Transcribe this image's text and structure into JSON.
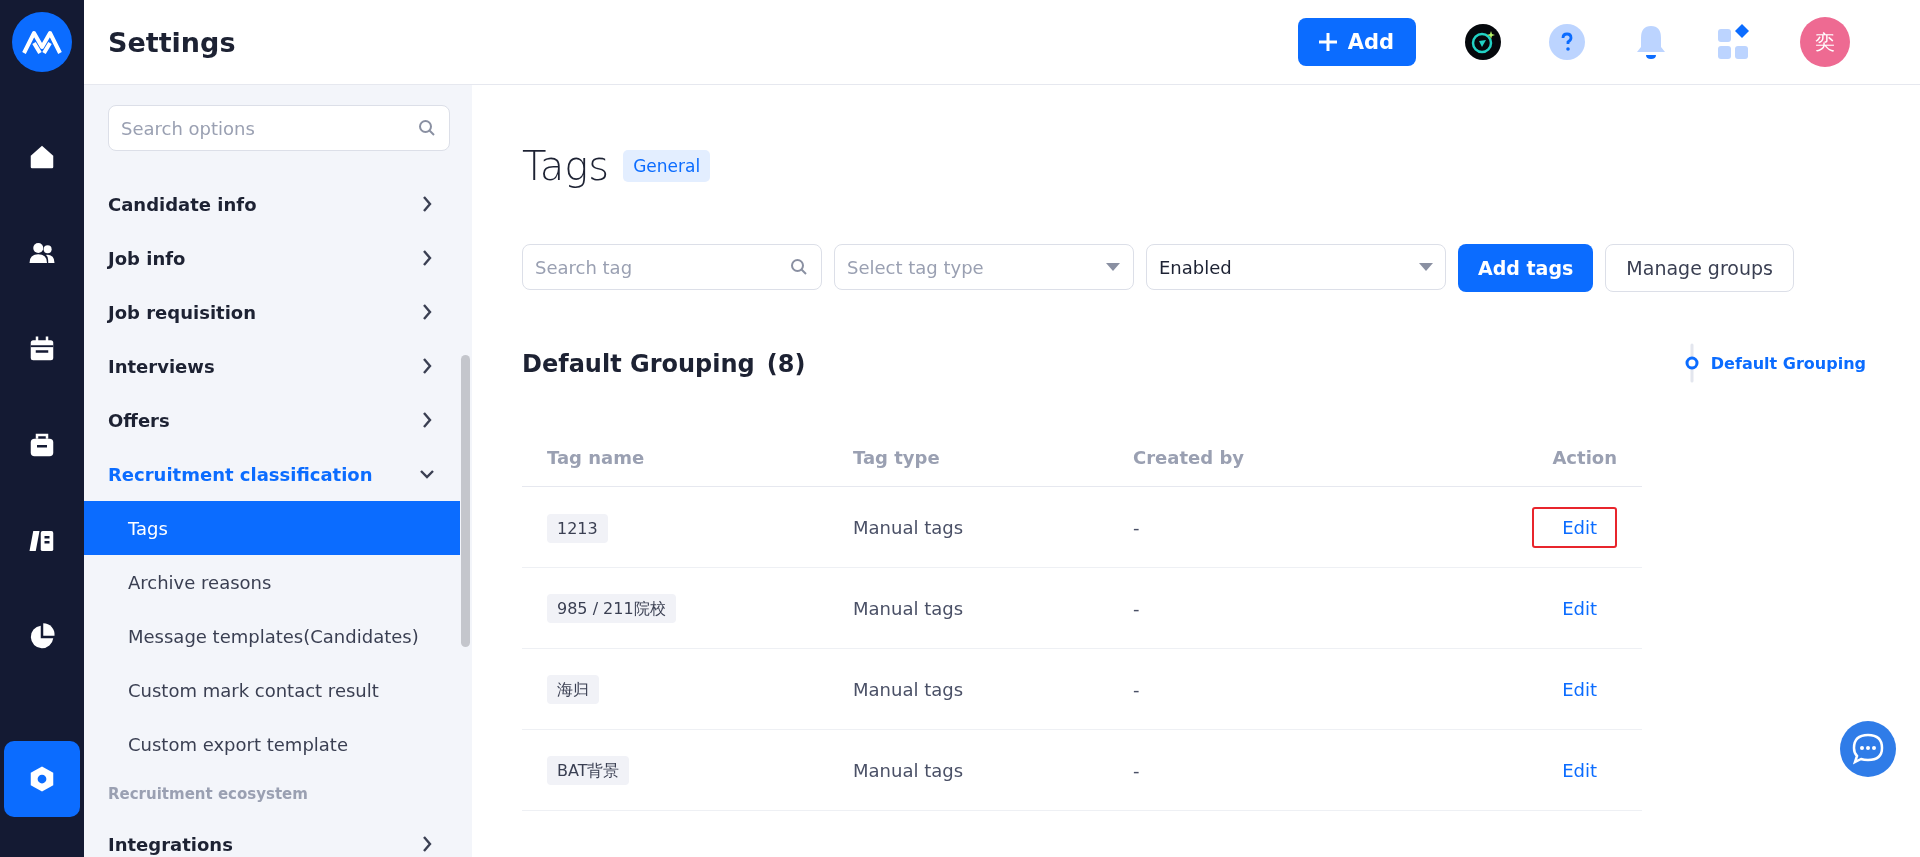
{
  "header": {
    "title": "Settings",
    "add_button": "Add",
    "avatar": "奕"
  },
  "rail": {
    "items": [
      {
        "kind": "home",
        "selected": false
      },
      {
        "kind": "people",
        "selected": false
      },
      {
        "kind": "calendar",
        "selected": false
      },
      {
        "kind": "bag",
        "selected": false
      },
      {
        "kind": "book",
        "selected": false
      },
      {
        "kind": "pie",
        "selected": false
      },
      {
        "kind": "settings",
        "selected": true
      }
    ]
  },
  "sidebar": {
    "search": {
      "placeholder": "Search options"
    },
    "items": [
      {
        "kind": "item",
        "label": "Candidate info",
        "expanded": false,
        "selected": false
      },
      {
        "kind": "item",
        "label": "Job info",
        "expanded": false,
        "selected": false
      },
      {
        "kind": "item",
        "label": "Job requisition",
        "expanded": false,
        "selected": false
      },
      {
        "kind": "item",
        "label": "Interviews",
        "expanded": false,
        "selected": false
      },
      {
        "kind": "item",
        "label": "Offers",
        "expanded": false,
        "selected": false
      },
      {
        "kind": "item",
        "label": "Recruitment classification",
        "expanded": true,
        "selected": false,
        "children": [
          {
            "label": "Tags",
            "selected": true
          },
          {
            "label": "Archive reasons",
            "selected": false
          },
          {
            "label": "Message templates(Candidates)",
            "selected": false
          },
          {
            "label": "Custom mark contact result",
            "selected": false
          },
          {
            "label": "Custom export template",
            "selected": false
          }
        ]
      },
      {
        "kind": "section",
        "label": "Recruitment ecosystem"
      },
      {
        "kind": "item",
        "label": "Integrations",
        "expanded": false,
        "selected": false
      }
    ]
  },
  "page": {
    "title": "Tags",
    "badge": "General",
    "filters": {
      "search": {
        "placeholder": "Search tag"
      },
      "type_select": {
        "placeholder": "Select tag type"
      },
      "status_select": {
        "value": "Enabled"
      },
      "buttons": [
        {
          "label": "Add tags",
          "kind": "primary"
        },
        {
          "label": "Manage groups",
          "kind": "default"
        }
      ]
    },
    "group": {
      "title": "Default Grouping",
      "count": "(8)"
    },
    "anchor": {
      "label": "Default Grouping",
      "selected": true
    },
    "table": {
      "columns": [
        "Tag name",
        "Tag type",
        "Created by",
        "Action"
      ],
      "rows": [
        {
          "name": "1213",
          "type": "Manual tags",
          "created_by": "-",
          "action": "Edit",
          "highlighted": true
        },
        {
          "name": "985 / 211院校",
          "type": "Manual tags",
          "created_by": "-",
          "action": "Edit",
          "highlighted": false
        },
        {
          "name": "海归",
          "type": "Manual tags",
          "created_by": "-",
          "action": "Edit",
          "highlighted": false
        },
        {
          "name": "BAT背景",
          "type": "Manual tags",
          "created_by": "-",
          "action": "Edit",
          "highlighted": false
        }
      ]
    }
  }
}
